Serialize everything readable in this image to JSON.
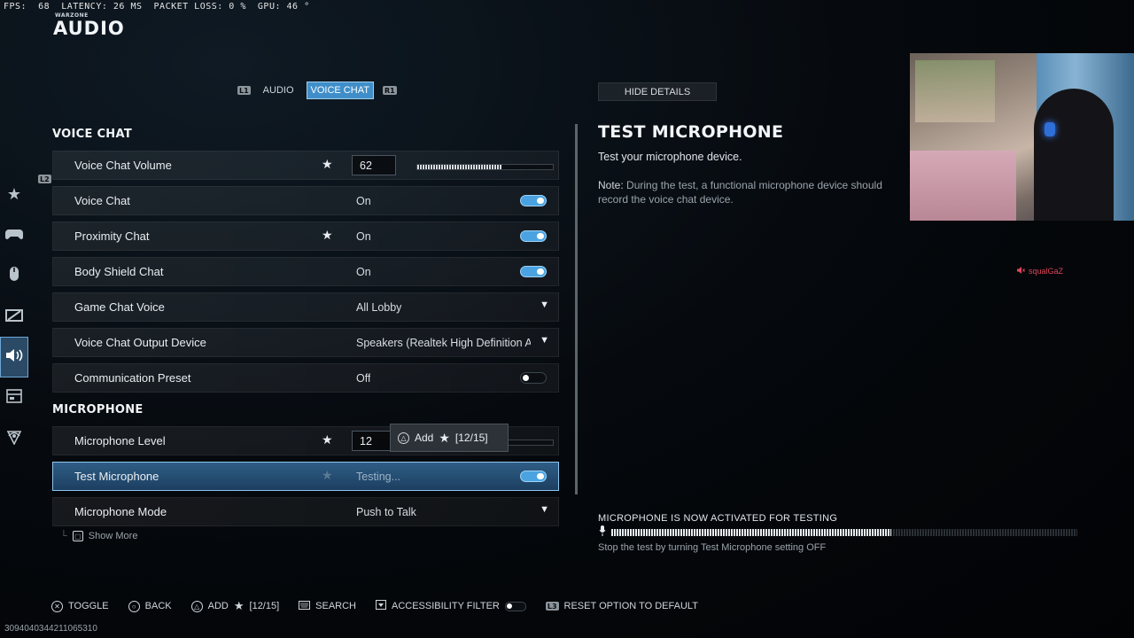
{
  "perf": {
    "text": "FPS:  68  LATENCY: 26 MS  PACKET LOSS: 0 %  GPU: 46 °"
  },
  "brand": "WARZONE",
  "page_title": "AUDIO",
  "tabs": {
    "left_button": "L1",
    "right_button": "R1",
    "items": [
      {
        "label": "AUDIO",
        "active": false
      },
      {
        "label": "VOICE CHAT",
        "active": true
      }
    ]
  },
  "rail": {
    "l2_button": "L2",
    "items": [
      {
        "icon": "star-icon"
      },
      {
        "icon": "controller-icon"
      },
      {
        "icon": "mouse-icon"
      },
      {
        "icon": "graphics-icon"
      },
      {
        "icon": "speaker-icon",
        "active": true
      },
      {
        "icon": "interface-icon"
      },
      {
        "icon": "network-icon"
      }
    ]
  },
  "sections": {
    "voice_chat": "VOICE CHAT",
    "microphone": "MICROPHONE"
  },
  "settings": {
    "voice_chat_volume": {
      "label": "Voice Chat Volume",
      "value": "62",
      "level": 0.62
    },
    "voice_chat": {
      "label": "Voice Chat",
      "value": "On"
    },
    "proximity_chat": {
      "label": "Proximity Chat",
      "value": "On"
    },
    "body_shield_chat": {
      "label": "Body Shield Chat",
      "value": "On"
    },
    "game_chat_voice": {
      "label": "Game Chat Voice",
      "value": "All Lobby"
    },
    "voice_chat_output_device": {
      "label": "Voice Chat Output Device",
      "value": "Speakers (Realtek High Definition Aud"
    },
    "communication_preset": {
      "label": "Communication Preset",
      "value": "Off"
    },
    "microphone_level": {
      "label": "Microphone Level",
      "value": "12",
      "level": 0.12
    },
    "test_microphone": {
      "label": "Test Microphone",
      "value": "Testing..."
    },
    "microphone_mode": {
      "label": "Microphone Mode",
      "value": "Push to Talk"
    }
  },
  "show_more": "Show More",
  "tooltip": {
    "label": "Add",
    "count": "[12/15]"
  },
  "details": {
    "hide_label": "HIDE DETAILS",
    "title": "TEST MICROPHONE",
    "description": "Test your microphone device.",
    "note_label": "Note:",
    "note_text": "During the test, a functional microphone device should record the voice chat device.",
    "mic_status": "MICROPHONE IS NOW ACTIVATED FOR TESTING",
    "mic_level": 0.6,
    "mic_hint": "Stop the test by turning Test Microphone setting OFF"
  },
  "webcam": {
    "username": "squalGaZ"
  },
  "footer": {
    "toggle": "TOGGLE",
    "back": "BACK",
    "add": "ADD",
    "add_count": "[12/15]",
    "search": "SEARCH",
    "accessibility": "ACCESSIBILITY FILTER",
    "reset_button": "L3",
    "reset": "RESET OPTION TO DEFAULT"
  },
  "build_id": "3094040344211065310",
  "colors": {
    "accent": "#4aa3e0",
    "selected_row": "#2f5d86",
    "mute_red": "#e0465a"
  }
}
